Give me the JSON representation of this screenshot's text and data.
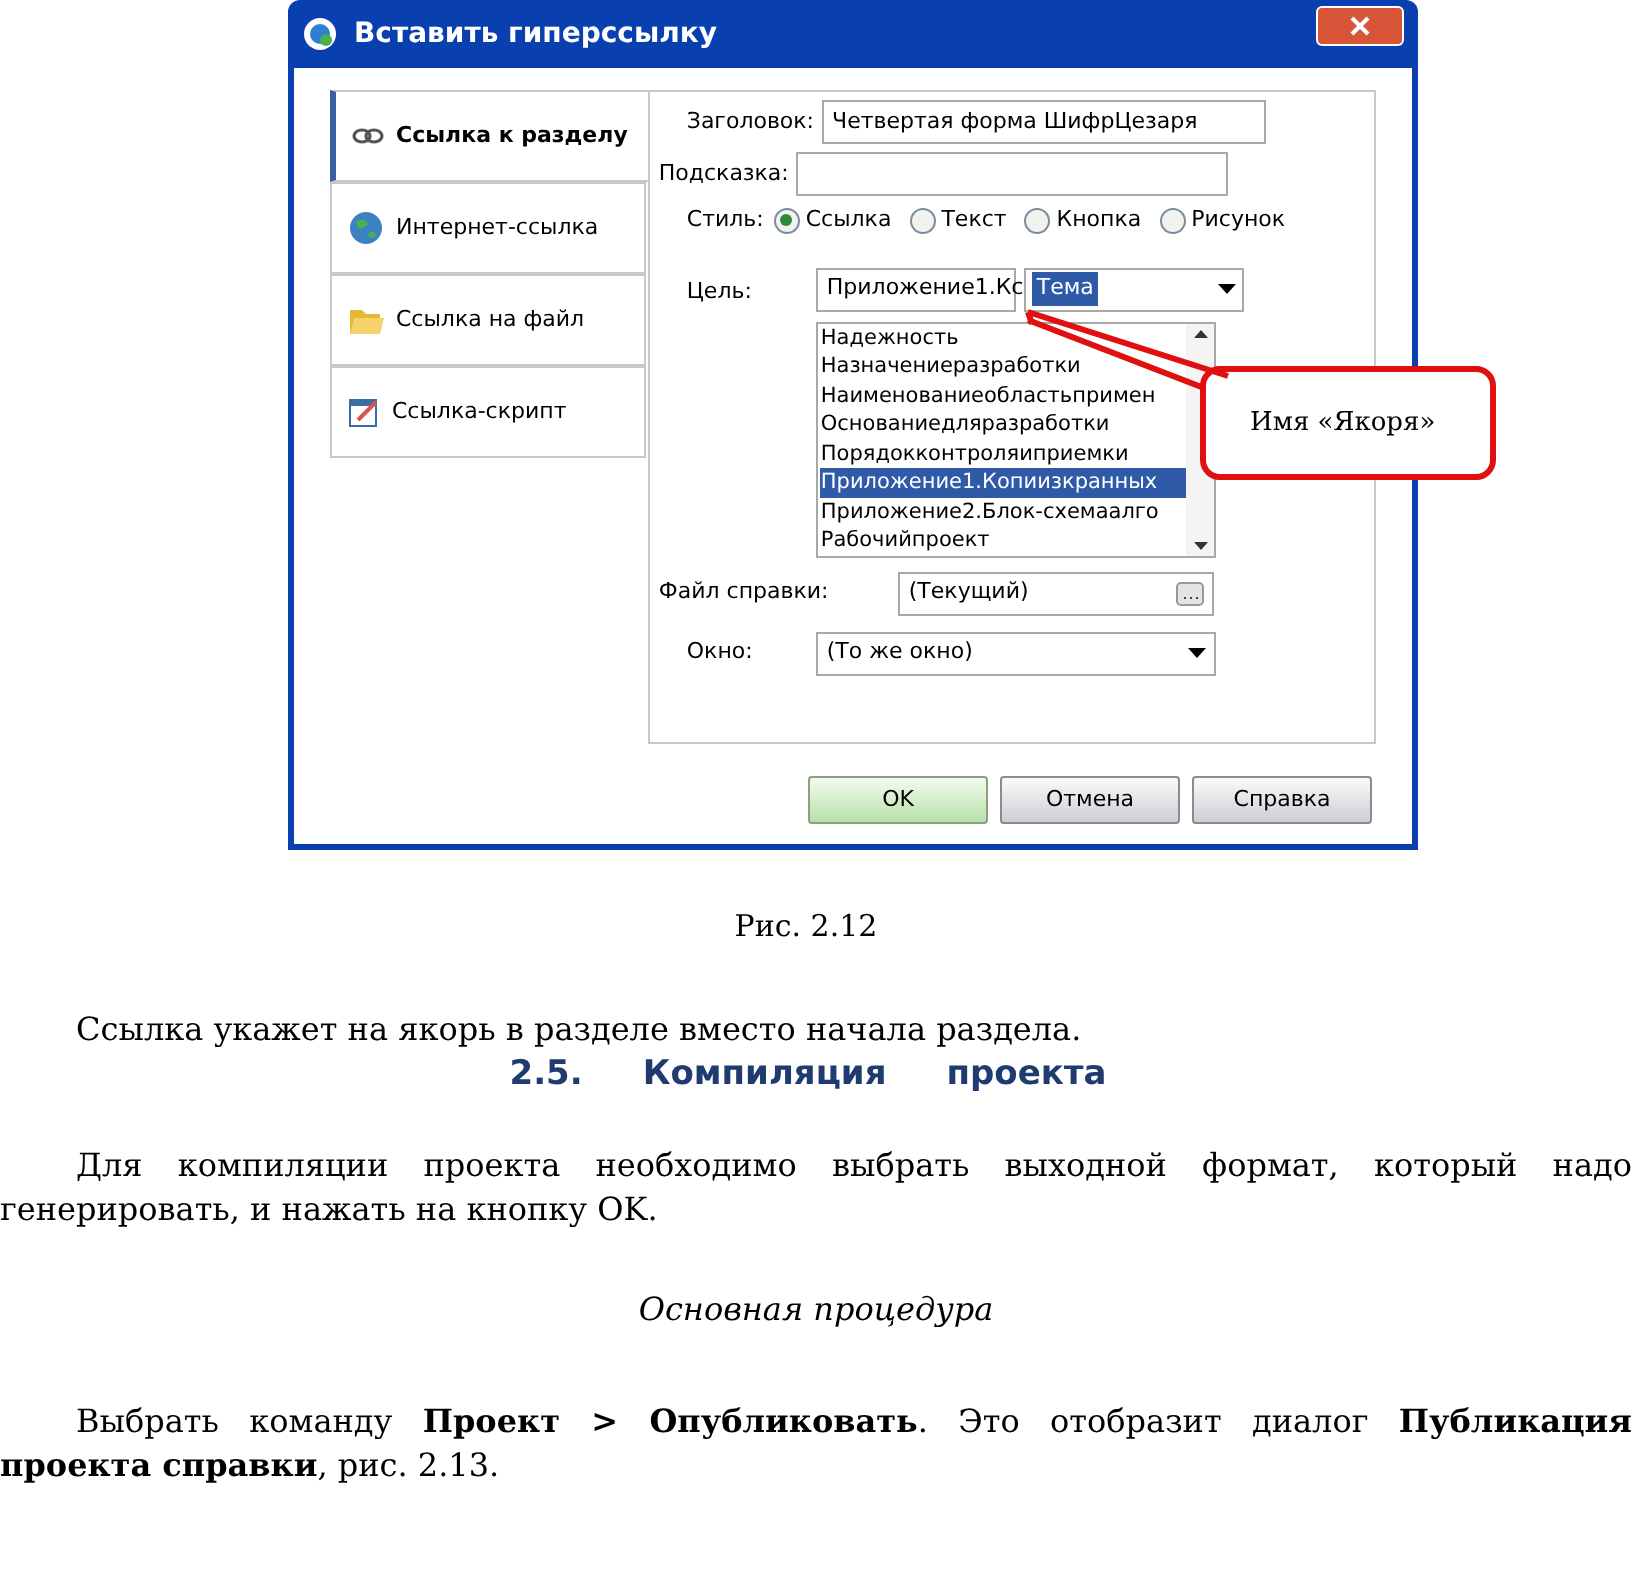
{
  "dialog": {
    "title": "Вставить гиперссылку",
    "tabs": [
      {
        "label": "Ссылка к разделу",
        "selected": true
      },
      {
        "label": "Интернет-ссылка",
        "selected": false
      },
      {
        "label": "Ссылка на файл",
        "selected": false
      },
      {
        "label": "Ссылка-скрипт",
        "selected": false
      }
    ],
    "title_label": "Заголовок:",
    "title_value": "Четвертая форма ШифрЦезаря",
    "hint_label": "Подсказка:",
    "style_label": "Стиль:",
    "styles": [
      {
        "label": "Ссылка",
        "selected": true
      },
      {
        "label": "Текст",
        "selected": false
      },
      {
        "label": "Кнопка",
        "selected": false
      },
      {
        "label": "Рисунок",
        "selected": false
      }
    ],
    "target_label": "Цель:",
    "target_value": "Приложение1.Кс",
    "anchor_value": "Тема",
    "anchors": [
      {
        "label": "Надежность",
        "selected": false
      },
      {
        "label": "Назначениеразработки",
        "selected": false
      },
      {
        "label": "Наименованиеобластьпримен",
        "selected": false
      },
      {
        "label": "Основаниедляразработки",
        "selected": false
      },
      {
        "label": "Порядокконтроляиприемки",
        "selected": false
      },
      {
        "label": "Приложение1.Копиизкранных",
        "selected": true
      },
      {
        "label": "Приложение2.Блок-схемаалго",
        "selected": false
      },
      {
        "label": "Рабочийпроект",
        "selected": false
      }
    ],
    "help_file_label": "Файл справки:",
    "help_file_value": "(Текущий)",
    "window_label": "Окно:",
    "window_value": "(То же окно)",
    "buttons": [
      {
        "label": "OK",
        "kind": "default"
      },
      {
        "label": "Отмена",
        "kind": "normal"
      },
      {
        "label": "Справка",
        "kind": "normal"
      }
    ]
  },
  "callout": {
    "text": "Имя «Якоря»"
  },
  "document": {
    "caption": "Рис. 2.12",
    "paragraph_1": "Ссылка укажет на якорь в разделе вместо начала раздела.",
    "heading": {
      "number": "2.5.",
      "title": "Компиляция",
      "title_2": "проекта"
    },
    "paragraph_2": "Для компиляции проекта необходимо выбрать выходной формат, который надо генерировать, и нажать на кнопку OK.",
    "subheading": "Основная процедура",
    "paragraph_3": "Выбрать команду **Проект > Опубликовать**. Это отобразит диалог **Публикация проекта справки**, рис. 2.13."
  }
}
